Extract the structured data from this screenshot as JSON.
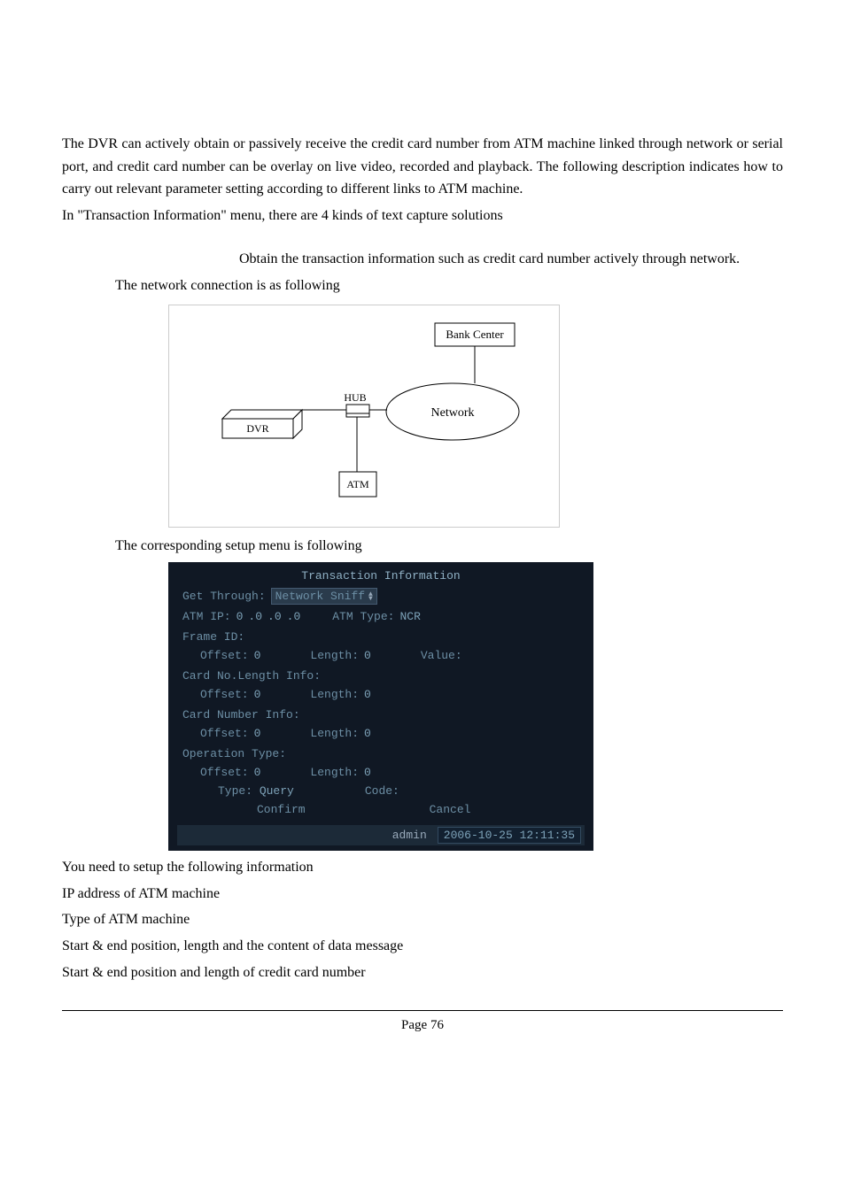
{
  "body": {
    "p1": "The DVR can actively obtain or passively receive the credit card number from ATM machine linked through network or serial port, and credit card number can be overlay on live video, recorded and playback. The following description indicates how to carry out relevant parameter setting according to different links to ATM machine.",
    "p2": "In \"Transaction Information\" menu, there are 4 kinds of text capture solutions",
    "p3": "Obtain the transaction information such as credit card number actively through network.",
    "p4": "The network connection is as following",
    "p5": "The corresponding setup menu is following",
    "p6": "You need to setup the following information",
    "p7": "IP address of ATM machine",
    "p8": "Type of ATM machine",
    "p9": "Start & end position, length and the content of data message",
    "p10": "Start & end position and length of credit card number"
  },
  "diagram": {
    "bank": "Bank Center",
    "hub": "HUB",
    "network": "Network",
    "dvr": "DVR",
    "atm": "ATM"
  },
  "menu": {
    "title": "Transaction Information",
    "get_through_label": "Get Through:",
    "get_through_value": "Network Sniff",
    "atm_ip_label": "ATM IP:",
    "ip0": "0",
    "ip1": ".0",
    "ip2": ".0",
    "ip3": ".0",
    "atm_type_label": "ATM Type:",
    "atm_type_value": "NCR",
    "frame_id": "Frame ID:",
    "offset_label": "Offset:",
    "length_label": "Length:",
    "value_label": "Value:",
    "zero": "0",
    "card_no_len": "Card No.Length Info:",
    "card_num": "Card Number Info:",
    "op_type": "Operation Type:",
    "type_label": "Type:",
    "type_value": "Query",
    "code_label": "Code:",
    "confirm": "Confirm",
    "cancel": "Cancel",
    "user": "admin",
    "timestamp": "2006-10-25 12:11:35"
  },
  "footer": {
    "page": "Page 76"
  }
}
